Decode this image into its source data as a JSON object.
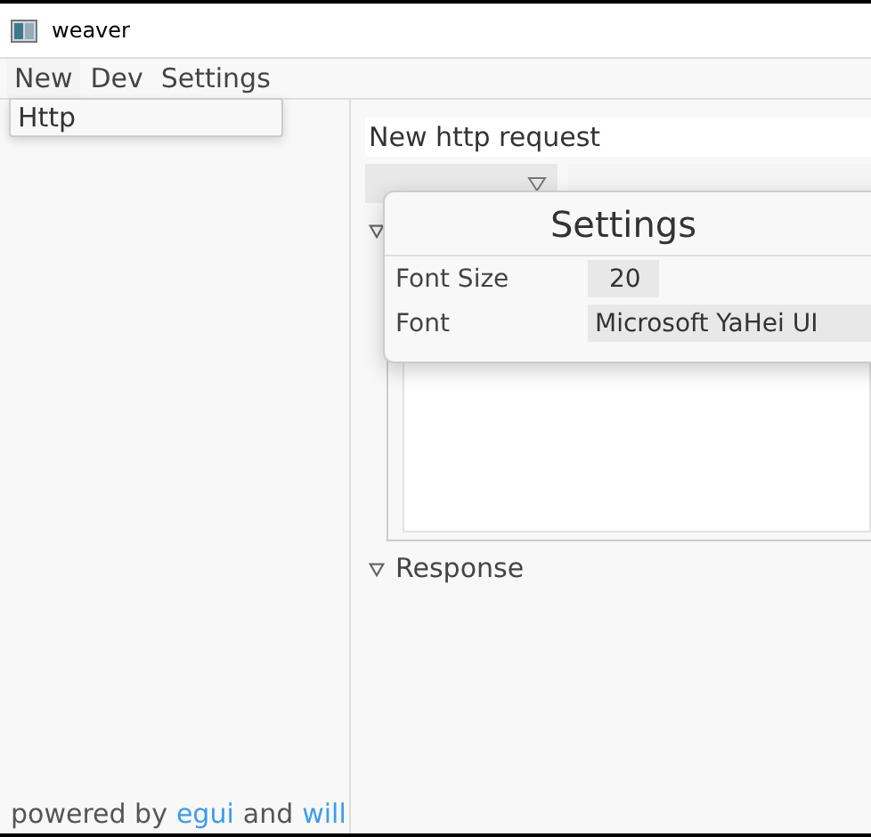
{
  "window": {
    "title": "weaver"
  },
  "menu_bar": {
    "items": [
      {
        "label": "New",
        "expanded": true
      },
      {
        "label": "Dev",
        "expanded": false
      },
      {
        "label": "Settings",
        "expanded": false
      }
    ]
  },
  "dropdown_menu": {
    "items": [
      "Http"
    ]
  },
  "request": {
    "title": "New http request",
    "body_section": {
      "expanded": true
    },
    "response_section": {
      "label": "Response",
      "expanded": true
    }
  },
  "settings_window": {
    "title": "Settings",
    "rows": [
      {
        "label": "Font Size",
        "value": "20",
        "kind": "number"
      },
      {
        "label": "Font",
        "value": "Microsoft YaHei UI",
        "kind": "text"
      }
    ]
  },
  "footer": {
    "parts": [
      {
        "text": "powered by",
        "kind": "plain"
      },
      {
        "text": "egui",
        "kind": "link"
      },
      {
        "text": "and",
        "kind": "plain"
      },
      {
        "text": "will",
        "kind": "link"
      }
    ]
  }
}
